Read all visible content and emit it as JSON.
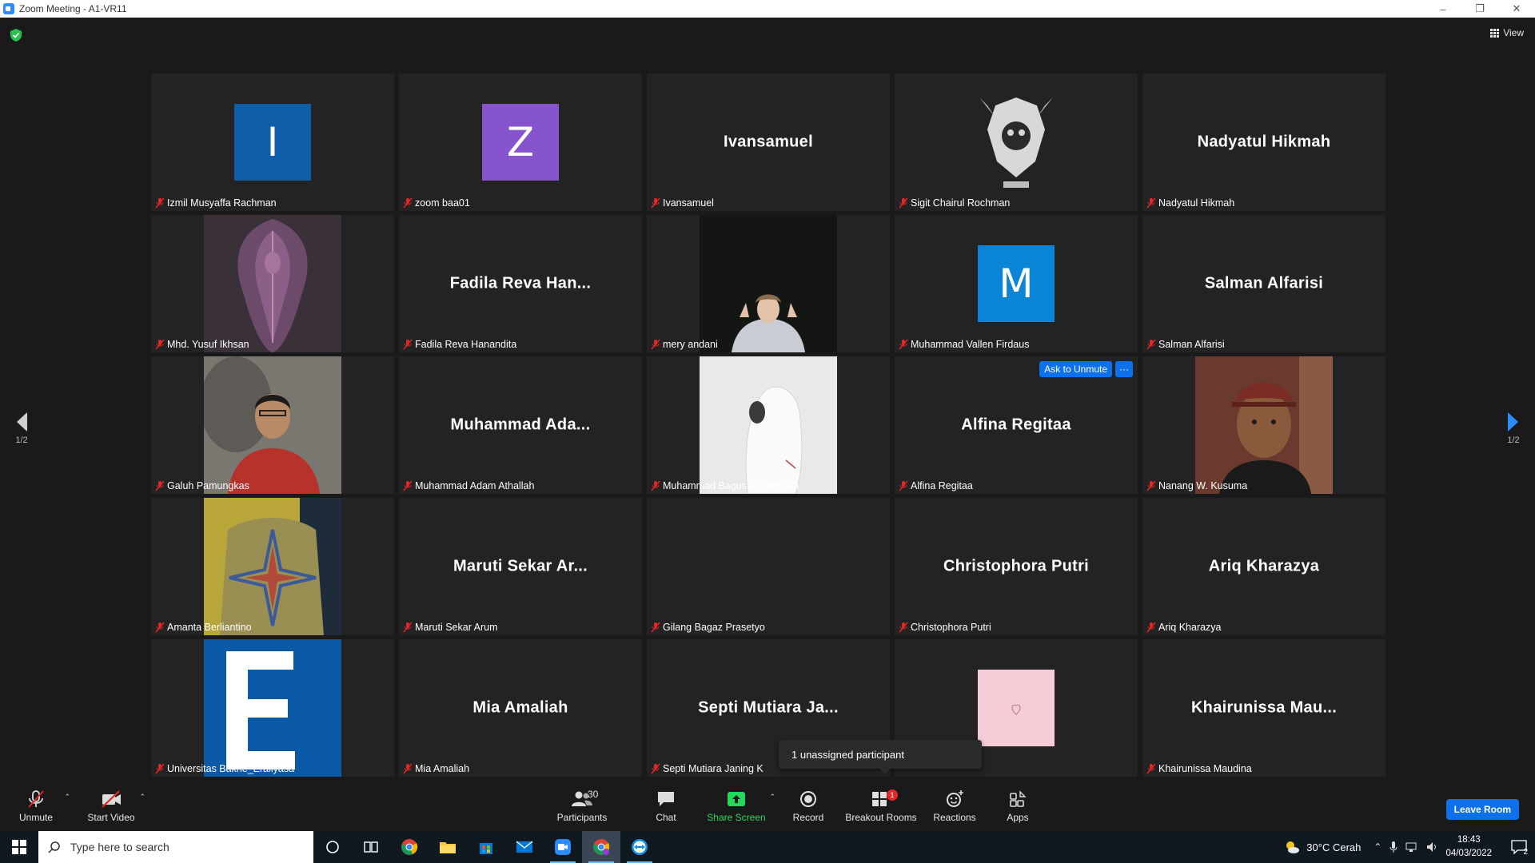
{
  "window": {
    "title": "Zoom Meeting - A1-VR11"
  },
  "view_button": {
    "label": "View"
  },
  "pager": {
    "left": "1/2",
    "right": "1/2"
  },
  "tiles": [
    {
      "name": "Izmil Musyaffa Rachman",
      "avatar_letter": "I",
      "avatar_color": "#0e5fa8",
      "kind": "letter"
    },
    {
      "name": "zoom baa01",
      "avatar_letter": "Z",
      "avatar_color": "#8654cc",
      "kind": "letter"
    },
    {
      "name": "Ivansamuel",
      "display": "Ivansamuel",
      "kind": "text"
    },
    {
      "name": "Sigit Chairul Rochman",
      "kind": "photo",
      "photo": "emblem"
    },
    {
      "name": "Nadyatul Hikmah",
      "display": "Nadyatul Hikmah",
      "kind": "text"
    },
    {
      "name": "Mhd. Yusuf Ikhsan",
      "kind": "photo",
      "photo": "armor"
    },
    {
      "name": "Fadila Reva Hanandita",
      "display": "Fadila Reva Han...",
      "kind": "text"
    },
    {
      "name": "mery andani",
      "kind": "photo",
      "photo": "dark-person"
    },
    {
      "name": "Muhammad Vallen Firdaus",
      "avatar_letter": "M",
      "avatar_color": "#0a84d6",
      "kind": "letter"
    },
    {
      "name": "Salman Alfarisi",
      "display": "Salman Alfarisi",
      "kind": "text"
    },
    {
      "name": "Galuh Pamungkas",
      "kind": "photo",
      "photo": "selfie"
    },
    {
      "name": "Muhammad Adam Athallah",
      "display": "Muhammad Ada...",
      "kind": "text"
    },
    {
      "name": "Muhammad Bagus Ardiansyah",
      "kind": "photo",
      "photo": "hoodie"
    },
    {
      "name": "Alfina Regitaa",
      "display": "Alfina Regitaa",
      "kind": "text",
      "ask_unmute": "Ask to Unmute",
      "more": "···"
    },
    {
      "name": "Nanang W. Kusuma",
      "kind": "photo",
      "photo": "beanie"
    },
    {
      "name": "Amanta Berliantino",
      "kind": "photo",
      "photo": "jacket"
    },
    {
      "name": "Maruti Sekar Arum",
      "display": "Maruti Sekar Ar...",
      "kind": "text"
    },
    {
      "name": "Gilang Bagaz Prasetyo",
      "kind": "empty"
    },
    {
      "name": "Christophora Putri",
      "display": "Christophora Putri",
      "kind": "text"
    },
    {
      "name": "Ariq Kharazya",
      "display": "Ariq Kharazya",
      "kind": "text"
    },
    {
      "name": "Universitas Bakrie_Erallyasa",
      "kind": "photo",
      "photo": "letter-e"
    },
    {
      "name": "Mia Amaliah",
      "display": "Mia Amaliah",
      "kind": "text"
    },
    {
      "name": "Septi Mutiara Janing K",
      "display": "Septi Mutiara Ja...",
      "kind": "text"
    },
    {
      "name": "",
      "kind": "photo",
      "photo": "pink-heart"
    },
    {
      "name": "Khairunissa Maudina",
      "display": "Khairunissa  Mau...",
      "kind": "text"
    }
  ],
  "tooltip": "1 unassigned participant",
  "toolbar": {
    "unmute": "Unmute",
    "start_video": "Start Video",
    "participants": "Participants",
    "participants_count": "30",
    "chat": "Chat",
    "share_screen": "Share Screen",
    "record": "Record",
    "breakout_rooms": "Breakout Rooms",
    "breakout_badge": "1",
    "reactions": "Reactions",
    "apps": "Apps",
    "leave": "Leave Room"
  },
  "taskbar": {
    "search_placeholder": "Type here to search",
    "weather": "30°C  Cerah",
    "time": "18:43",
    "date": "04/03/2022",
    "notifications": "2"
  }
}
